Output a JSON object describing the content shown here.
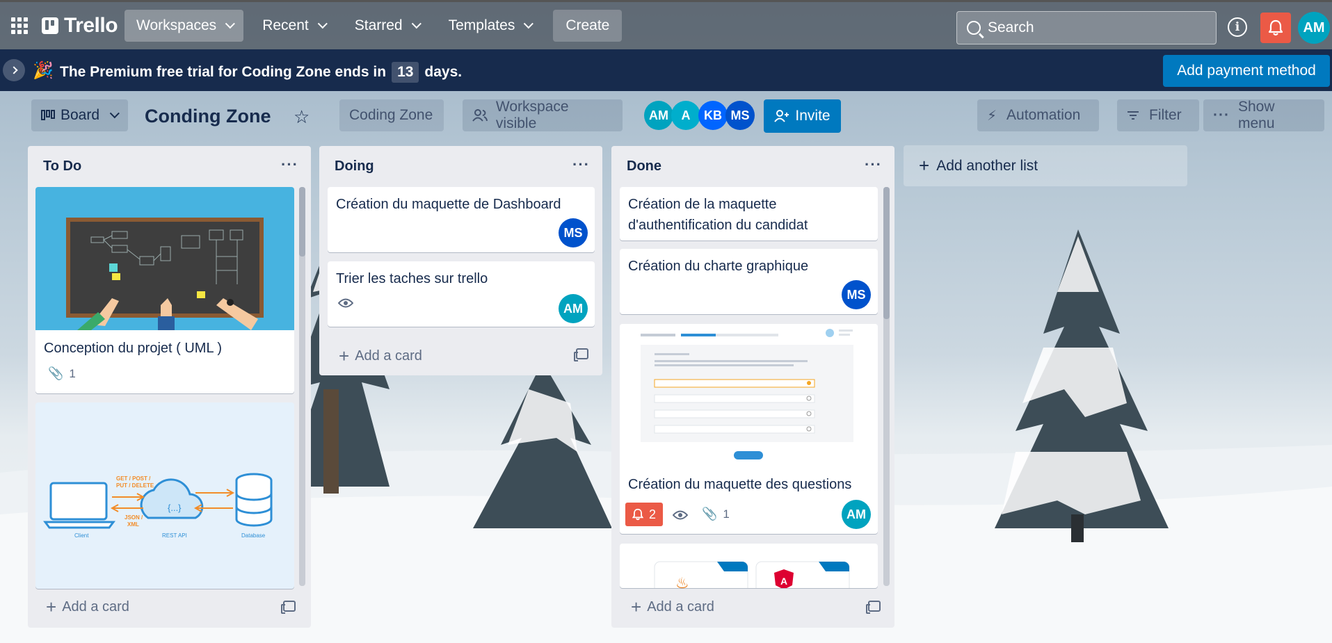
{
  "topnav": {
    "logo": "Trello",
    "workspaces": "Workspaces",
    "recent": "Recent",
    "starred": "Starred",
    "templates": "Templates",
    "create": "Create",
    "search_placeholder": "Search",
    "user_initials": "AM"
  },
  "banner": {
    "text_before": "The Premium free trial for Coding Zone ends in",
    "days": "13",
    "text_after": "days.",
    "pay_button": "Add payment method"
  },
  "board_header": {
    "view": "Board",
    "title": "Conding Zone",
    "workspace": "Coding Zone",
    "visibility": "Workspace visible",
    "members": [
      {
        "initials": "AM",
        "color": "#00a3bf"
      },
      {
        "initials": "A",
        "color": "#00aecc"
      },
      {
        "initials": "KB",
        "color": "#0065ff"
      },
      {
        "initials": "MS",
        "color": "#0052cc"
      }
    ],
    "invite": "Invite",
    "automation": "Automation",
    "filter": "Filter",
    "show_menu": "Show menu"
  },
  "lists": [
    {
      "title": "To Do",
      "add_card": "Add a card",
      "cards": [
        {
          "title": "Conception du projet ( UML )",
          "attachments": "1"
        },
        {
          "title": "",
          "diagram_labels": [
            "GET / POST /",
            "PUT / DELETE",
            "JSON /",
            "XML",
            "Client",
            "REST API",
            "Database"
          ]
        }
      ]
    },
    {
      "title": "Doing",
      "add_card": "Add a card",
      "cards": [
        {
          "title": "Création du maquette de Dashboard",
          "member": "MS"
        },
        {
          "title": "Trier les taches sur trello",
          "member": "AM"
        }
      ]
    },
    {
      "title": "Done",
      "add_card": "Add a card",
      "cards": [
        {
          "title_line1": "Création de la maquette",
          "title_line2": "d'authentification du candidat"
        },
        {
          "title": "Création du charte graphique",
          "member": "MS"
        },
        {
          "title": "Création du maquette des questions",
          "notifications": "2",
          "attachments": "1",
          "member": "AM"
        }
      ]
    }
  ],
  "add_list": "Add another list",
  "colors": {
    "accent": "#0079bf",
    "banner": "#172b4d",
    "danger": "#eb5a46"
  }
}
